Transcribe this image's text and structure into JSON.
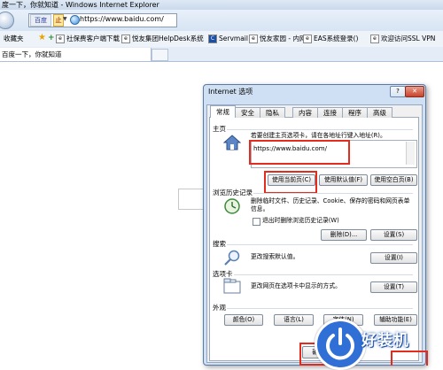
{
  "window": {
    "title": "度一下，你就知道 - Windows Internet Explorer"
  },
  "address_bar": {
    "badge": "百度",
    "compat": "止",
    "url": "https://www.baidu.com/"
  },
  "favorites_bar": {
    "label": "收藏夹",
    "items": [
      "社保费客户端下载",
      "悦友集团HelpDesk系统",
      "Servmail",
      "悦友家园 - 内网",
      "EAS系统登录()",
      "欢迎访问SSL VPN"
    ]
  },
  "tabs": [
    {
      "label": "百度一下，你就知道"
    }
  ],
  "dialog": {
    "title": "Internet 选项",
    "help": "?",
    "close": "✕",
    "tabs": [
      "常规",
      "安全",
      "隐私",
      "内容",
      "连接",
      "程序",
      "高级"
    ],
    "home": {
      "group": "主页",
      "desc": "若要创建主页选项卡，请在各地址行键入地址(R)。",
      "url": "https://www.baidu.com/",
      "buttons": [
        "使用当前页(C)",
        "使用默认值(F)",
        "使用空白页(B)"
      ]
    },
    "history": {
      "group": "浏览历史记录",
      "desc": "删除临时文件、历史记录、Cookie、保存的密码和网页表单信息。",
      "checkbox": "退出时删除浏览历史记录(W)",
      "buttons": [
        "删除(D)...",
        "设置(S)"
      ]
    },
    "search": {
      "group": "搜索",
      "desc": "更改搜索默认值。",
      "button": "设置(I)"
    },
    "tabs_section": {
      "group": "选项卡",
      "desc": "更改网页在选项卡中显示的方式。",
      "button": "设置(T)"
    },
    "appearance": {
      "group": "外观",
      "buttons": [
        "颜色(O)",
        "语言(L)",
        "字体(N)",
        "辅助功能(E)"
      ]
    },
    "footer": {
      "ok": "确定"
    }
  },
  "watermark": {
    "text": "好装机"
  },
  "colors": {
    "highlight": "#e32b1e",
    "dialog_frame": "#cfe0f4",
    "watermark": "#2f6fd6"
  }
}
